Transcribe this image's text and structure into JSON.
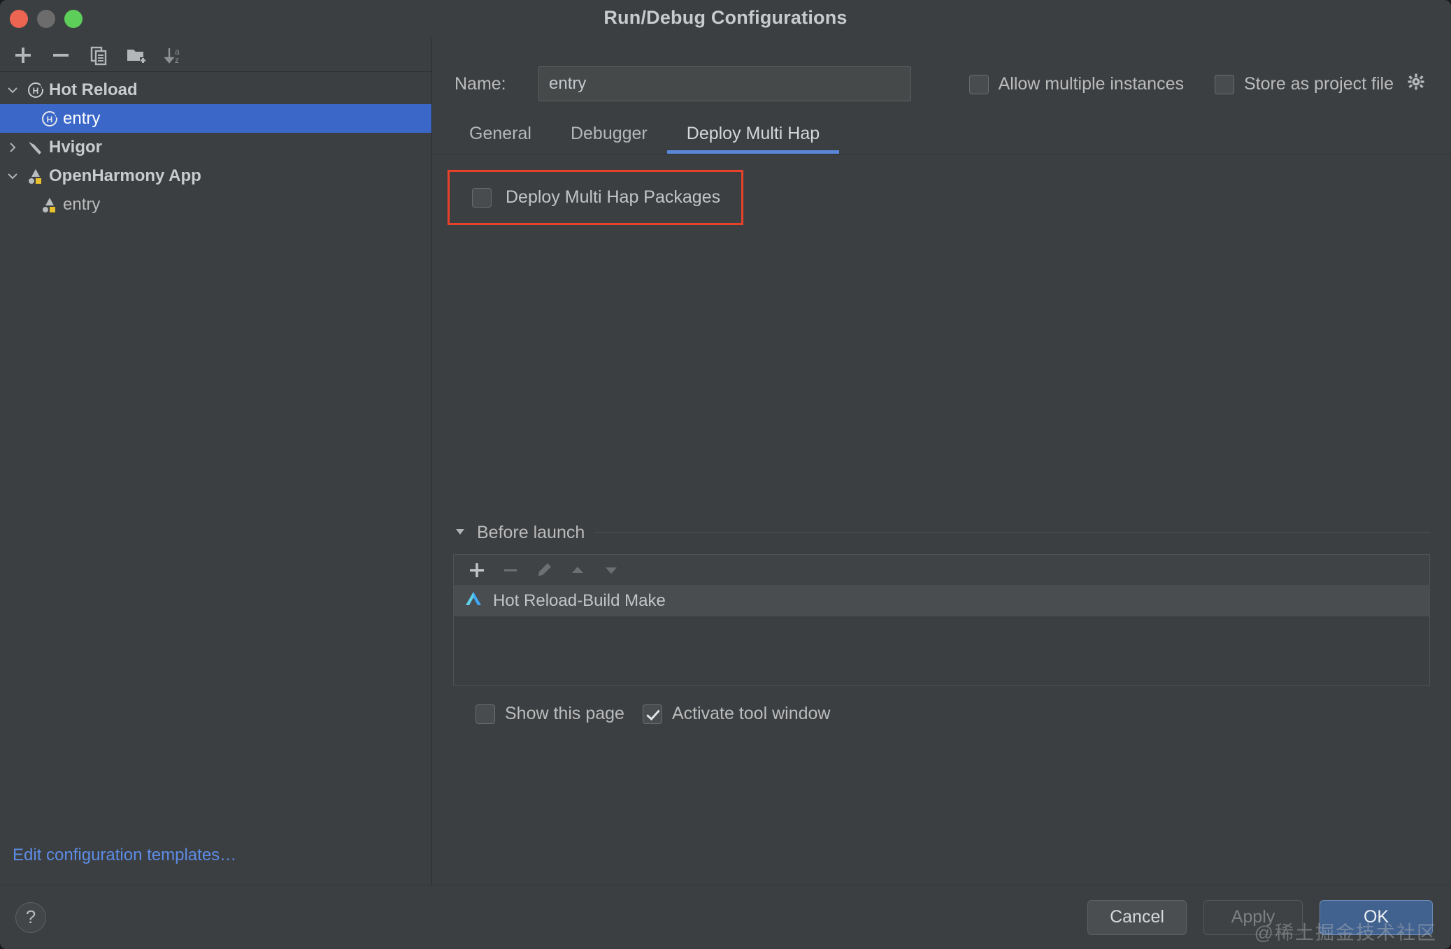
{
  "window": {
    "title": "Run/Debug Configurations",
    "traffic_lights": [
      "close-red",
      "minimize-gray",
      "zoom-green"
    ]
  },
  "sidebar": {
    "toolbar": [
      {
        "name": "add",
        "icon": "plus-icon",
        "label": "+"
      },
      {
        "name": "remove",
        "icon": "minus-icon",
        "label": "−"
      },
      {
        "name": "copy",
        "icon": "copy-icon",
        "label": "Copy Configuration"
      },
      {
        "name": "new-folder",
        "icon": "folder-add-icon",
        "label": "Create New Folder"
      },
      {
        "name": "sort",
        "icon": "sort-alphabetically-icon",
        "label": "Sort Configurations"
      }
    ],
    "tree": [
      {
        "label": "Hot Reload",
        "icon": "hot-reload-icon",
        "level": 0,
        "expanded": true,
        "selected": false,
        "has_arrow": true
      },
      {
        "label": "entry",
        "icon": "hot-reload-icon",
        "level": 1,
        "expanded": false,
        "selected": true,
        "has_arrow": false
      },
      {
        "label": "Hvigor",
        "icon": "hvigor-hammer-icon",
        "level": 0,
        "expanded": false,
        "selected": false,
        "has_arrow": true
      },
      {
        "label": "OpenHarmony App",
        "icon": "openharmony-icon",
        "level": 0,
        "expanded": true,
        "selected": false,
        "has_arrow": true
      },
      {
        "label": "entry",
        "icon": "openharmony-icon",
        "level": 1,
        "expanded": false,
        "selected": false,
        "has_arrow": false
      }
    ],
    "edit_templates_link": "Edit configuration templates…"
  },
  "main": {
    "name_label": "Name:",
    "name_value": "entry",
    "name_placeholder": "Name",
    "top_checkboxes": [
      {
        "label": "Allow multiple instances",
        "checked": false
      },
      {
        "label": "Store as project file",
        "checked": false
      }
    ],
    "gear_icon": "gear-icon",
    "tabs": [
      {
        "label": "General",
        "active": false
      },
      {
        "label": "Debugger",
        "active": false
      },
      {
        "label": "Deploy Multi Hap",
        "active": true
      }
    ],
    "deploy_multi_hap": {
      "checkbox_label": "Deploy Multi Hap Packages",
      "checked": false,
      "highlight_color": "#e8412a"
    },
    "before_launch": {
      "title": "Before launch",
      "expanded": true,
      "toolbar": [
        {
          "name": "add-task",
          "icon": "plus-icon",
          "enabled": true
        },
        {
          "name": "remove-task",
          "icon": "minus-icon",
          "enabled": false
        },
        {
          "name": "edit-task",
          "icon": "pencil-icon",
          "enabled": false
        },
        {
          "name": "move-up",
          "icon": "arrow-up-icon",
          "enabled": false
        },
        {
          "name": "move-down",
          "icon": "arrow-down-icon",
          "enabled": false
        }
      ],
      "items": [
        {
          "label": "Hot Reload-Build Make",
          "icon": "deveco-build-icon"
        }
      ]
    },
    "bottom_checkboxes": [
      {
        "label": "Show this page",
        "checked": false
      },
      {
        "label": "Activate tool window",
        "checked": true
      }
    ],
    "watermark": "@稀土掘金技术社区"
  },
  "footer": {
    "help_label": "?",
    "buttons": [
      {
        "label": "Cancel",
        "style": "secondary"
      },
      {
        "label": "Apply",
        "style": "disabled"
      },
      {
        "label": "OK",
        "style": "primary"
      }
    ]
  },
  "colors": {
    "accent_blue": "#3a67c8",
    "tab_underline": "#5a86d8",
    "link_blue": "#5c8ce6",
    "highlight_red": "#e8412a",
    "ok_button": "#41618f"
  }
}
